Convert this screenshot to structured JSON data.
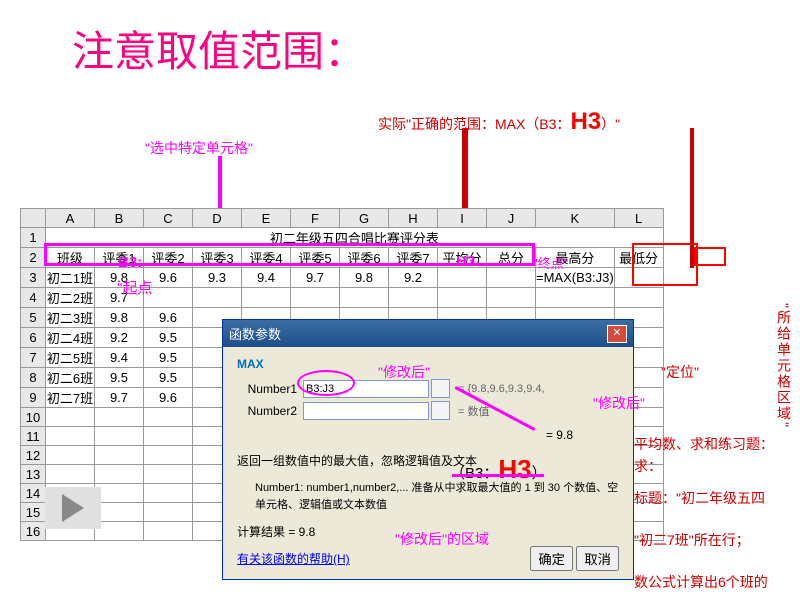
{
  "title": "注意取值范围：",
  "anno": {
    "select": "\"选中特定单元格\"",
    "actual_pre": "实际\"正确的范围：MAX（B3：",
    "actual_h3": "H3",
    "actual_post": "）\"",
    "b3": "B3:",
    "h3": "H3",
    "qidian": "\"起点",
    "zhongdian": "\"终点\"",
    "xgb1": "\"修改后\"",
    "xgb2": "\"修改后\"",
    "xgb_area": "\"修改后\"的区域",
    "b3h3_pre": "（B3：",
    "b3h3_h3": "H3",
    "b3h3_post": "）",
    "dingwei": "\"定位\"",
    "suogei": "\"所给单元格区域\"",
    "side1": "平均数、求和练习题：",
    "side2": "求：",
    "side3": "标题：\"初二年级五四",
    "side4": "\"初二7班\"所在行；",
    "side5": "数公式计算出6个班的"
  },
  "columns": [
    "",
    "A",
    "B",
    "C",
    "D",
    "E",
    "F",
    "G",
    "H",
    "I",
    "J",
    "K",
    "L"
  ],
  "sheet": {
    "title": "初二年级五四合唱比赛评分表",
    "headers": [
      "班级",
      "评委1",
      "评委2",
      "评委3",
      "评委4",
      "评委5",
      "评委6",
      "评委7",
      "平均分",
      "总分",
      "最高分",
      "最低分"
    ],
    "rows": [
      {
        "n": "3",
        "c": [
          "初二1班",
          "9.8",
          "9.6",
          "9.3",
          "9.4",
          "9.7",
          "9.8",
          "9.2",
          "",
          "",
          "=MAX(B3:J3)",
          ""
        ]
      },
      {
        "n": "4",
        "c": [
          "初二2班",
          "9.7",
          "",
          "",
          "",
          "",
          "",
          "",
          "",
          "",
          "",
          ""
        ]
      },
      {
        "n": "5",
        "c": [
          "初二3班",
          "9.8",
          "9.6",
          "",
          "",
          "",
          "",
          "",
          "",
          "",
          "",
          ""
        ]
      },
      {
        "n": "6",
        "c": [
          "初二4班",
          "9.2",
          "9.5",
          "",
          "",
          "",
          "",
          "",
          "",
          "",
          "",
          ""
        ]
      },
      {
        "n": "7",
        "c": [
          "初二5班",
          "9.4",
          "9.5",
          "",
          "",
          "",
          "",
          "",
          "",
          "",
          "",
          ""
        ]
      },
      {
        "n": "8",
        "c": [
          "初二6班",
          "9.5",
          "9.5",
          "",
          "",
          "",
          "",
          "",
          "",
          "",
          "",
          ""
        ]
      },
      {
        "n": "9",
        "c": [
          "初二7班",
          "9.7",
          "9.6",
          "",
          "",
          "",
          "",
          "",
          "",
          "",
          "",
          ""
        ]
      }
    ],
    "empty": [
      "10",
      "11",
      "12",
      "13",
      "14",
      "15",
      "16"
    ]
  },
  "dialog": {
    "title": "函数参数",
    "func": "MAX",
    "n1": "Number1",
    "n1v": "B3:J3",
    "n1eq": "= {9.8,9.6,9.3,9.4,",
    "n2": "Number2",
    "n2eq": "= 数值",
    "r": "= 9.8",
    "desc": "返回一组数值中的最大值，忽略逻辑值及文本",
    "desc2": "Number1:   number1,number2,... 准备从中求取最大值的 1 到 30 个数值、空单元格、逻辑值或文本数值",
    "res": "计算结果 =    9.8",
    "help": "有关该函数的帮助(H)",
    "ok": "确定",
    "cancel": "取消"
  }
}
